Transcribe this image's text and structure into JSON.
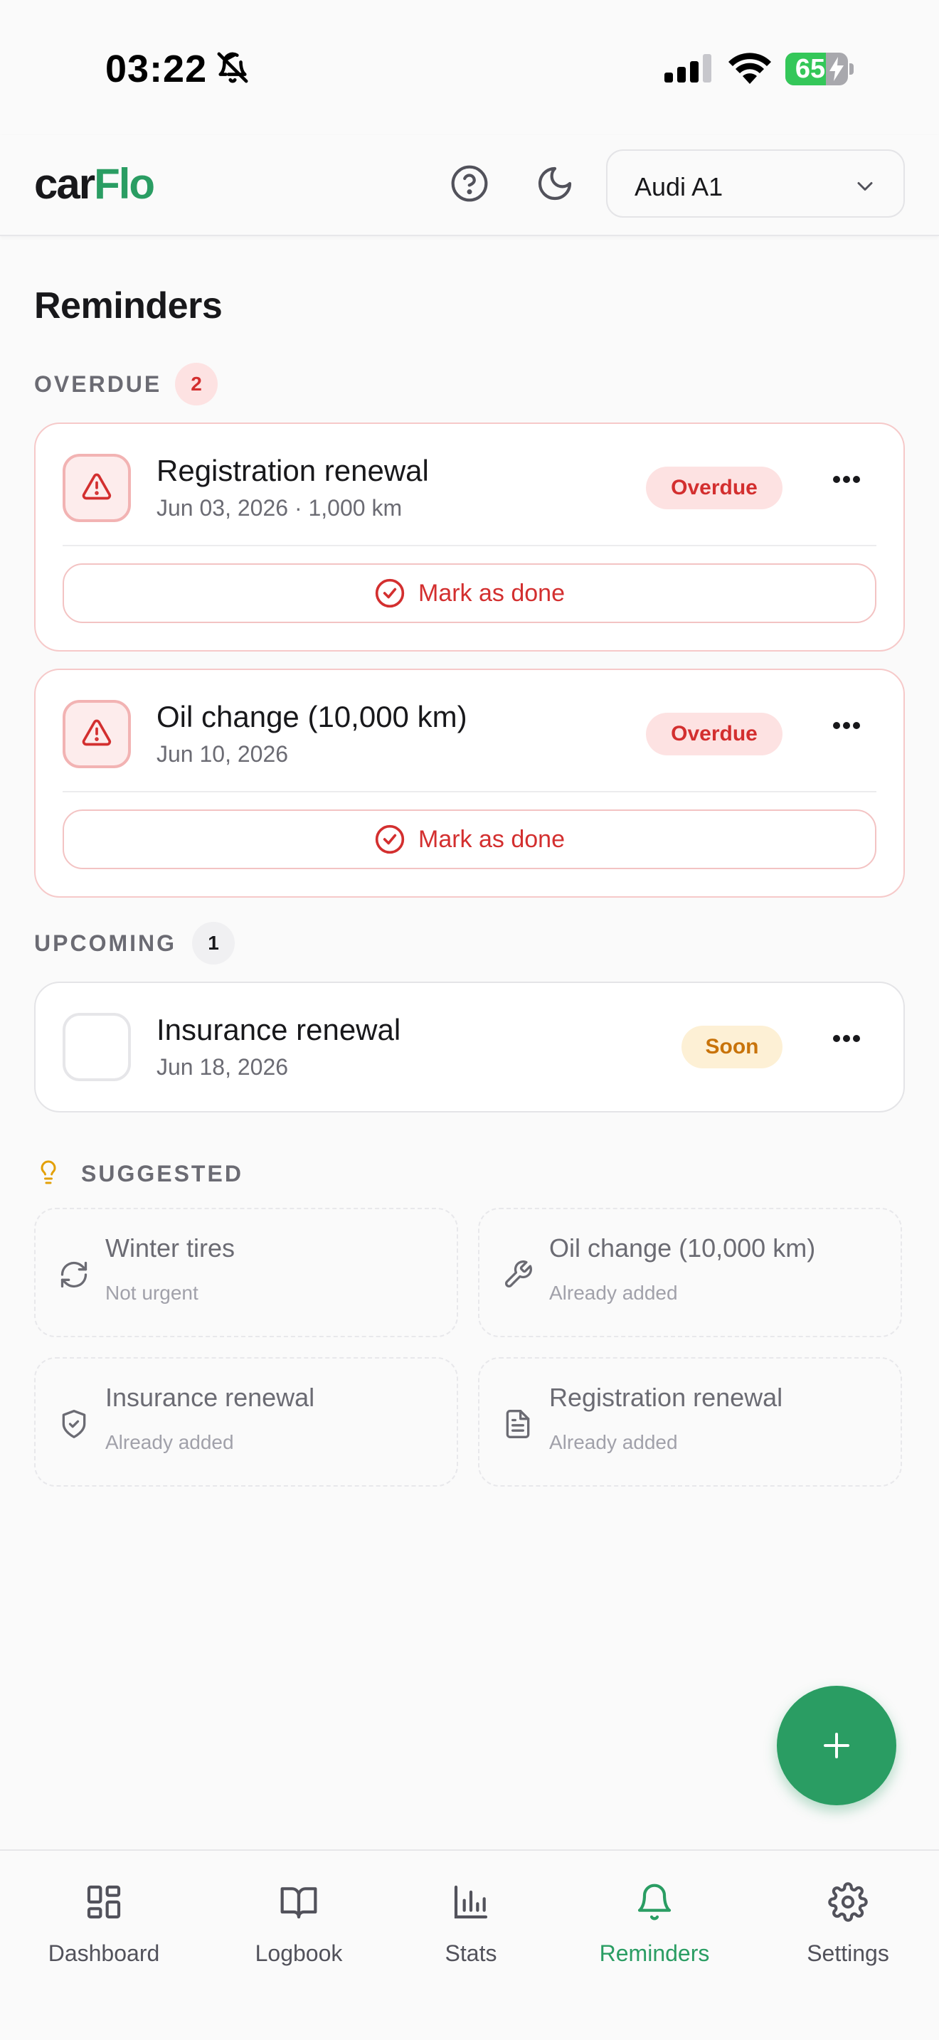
{
  "status_bar": {
    "time": "03:22",
    "battery_level": "65",
    "battery_fraction": 0.65
  },
  "header": {
    "logo_part1": "car",
    "logo_part2": "Flo",
    "vehicle": "Audi A1"
  },
  "page": {
    "title": "Reminders"
  },
  "overdue": {
    "label": "OVERDUE",
    "count": "2",
    "items": [
      {
        "title": "Registration renewal",
        "subtitle": "Jun 03, 2026 · 1,000 km",
        "status": "Overdue",
        "action": "Mark as done"
      },
      {
        "title": "Oil change (10,000 km)",
        "subtitle": "Jun 10, 2026",
        "status": "Overdue",
        "action": "Mark as done"
      }
    ]
  },
  "upcoming": {
    "label": "UPCOMING",
    "count": "1",
    "items": [
      {
        "title": "Insurance renewal",
        "subtitle": "Jun 18, 2026",
        "status": "Soon"
      }
    ]
  },
  "suggested": {
    "label": "SUGGESTED",
    "items": [
      {
        "title": "Winter tires",
        "subtitle": "Not urgent",
        "icon": "refresh-icon"
      },
      {
        "title": "Oil change (10,000 km)",
        "subtitle": "Already added",
        "icon": "wrench-icon"
      },
      {
        "title": "Insurance renewal",
        "subtitle": "Already added",
        "icon": "shield-check-icon"
      },
      {
        "title": "Registration renewal",
        "subtitle": "Already added",
        "icon": "document-icon"
      }
    ]
  },
  "nav": {
    "items": [
      {
        "label": "Dashboard",
        "icon": "dashboard-icon",
        "active": false
      },
      {
        "label": "Logbook",
        "icon": "book-icon",
        "active": false
      },
      {
        "label": "Stats",
        "icon": "chart-icon",
        "active": false
      },
      {
        "label": "Reminders",
        "icon": "bell-icon",
        "active": true
      },
      {
        "label": "Settings",
        "icon": "gear-icon",
        "active": false
      }
    ]
  },
  "colors": {
    "brand": "#2a9d63",
    "overdue": "#d32f2f",
    "soon": "#c8730a",
    "suggested_bulb": "#e3a008"
  }
}
